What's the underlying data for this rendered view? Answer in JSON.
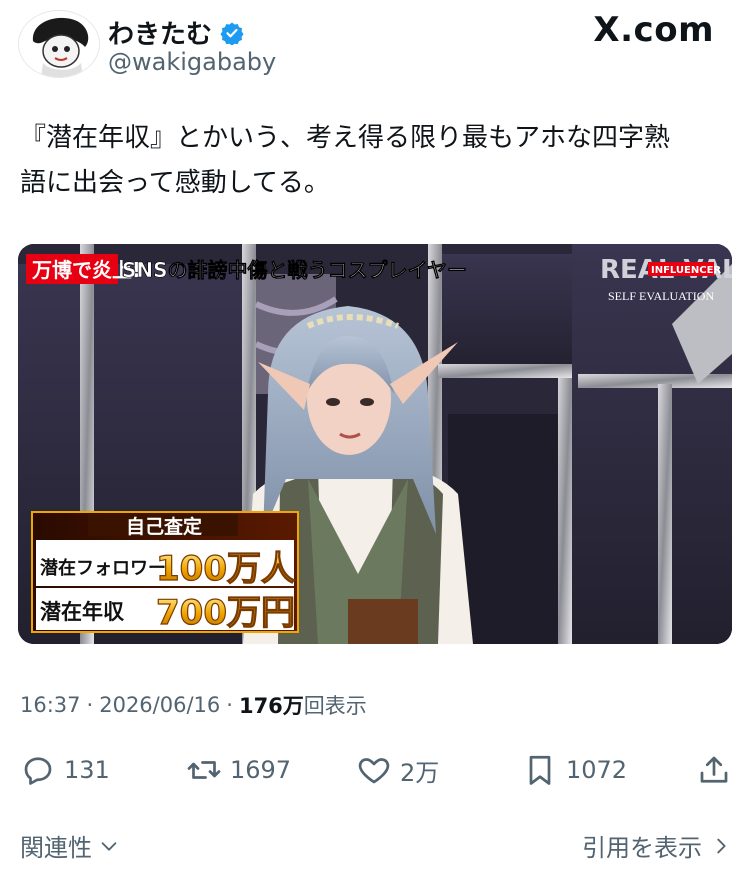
{
  "header": {
    "display_name": "わきたむ",
    "handle": "@wakigababy",
    "brand": "X.com",
    "verified_color": "#1d9bf0"
  },
  "tweet": {
    "text_line1": "『潜在年収』とかいう、考え得る限り最もアホな四字熟",
    "text_line2": "語に出会って感動してる。"
  },
  "media": {
    "banner_red": "万博で炎上!",
    "banner_white": "SNSの誹謗中傷と戦うコスプレイヤー",
    "logo_main": "REAL VALUE",
    "logo_sub": "INFLUENCER",
    "logo_caption": "SELF EVALUATION",
    "caption_title": "自己査定",
    "row1_label": "潜在フォロワー",
    "row1_value": "100万人",
    "row2_label": "潜在年収",
    "row2_value": "700万円"
  },
  "meta": {
    "time": "16:37",
    "sep1": "·",
    "date": "2026/06/16",
    "sep2": "·",
    "views_count": "176万",
    "views_label": "回表示"
  },
  "actions": {
    "replies": "131",
    "reposts": "1697",
    "likes": "2万",
    "bookmarks": "1072"
  },
  "footer": {
    "related": "関連性",
    "view_quotes": "引用を表示"
  }
}
